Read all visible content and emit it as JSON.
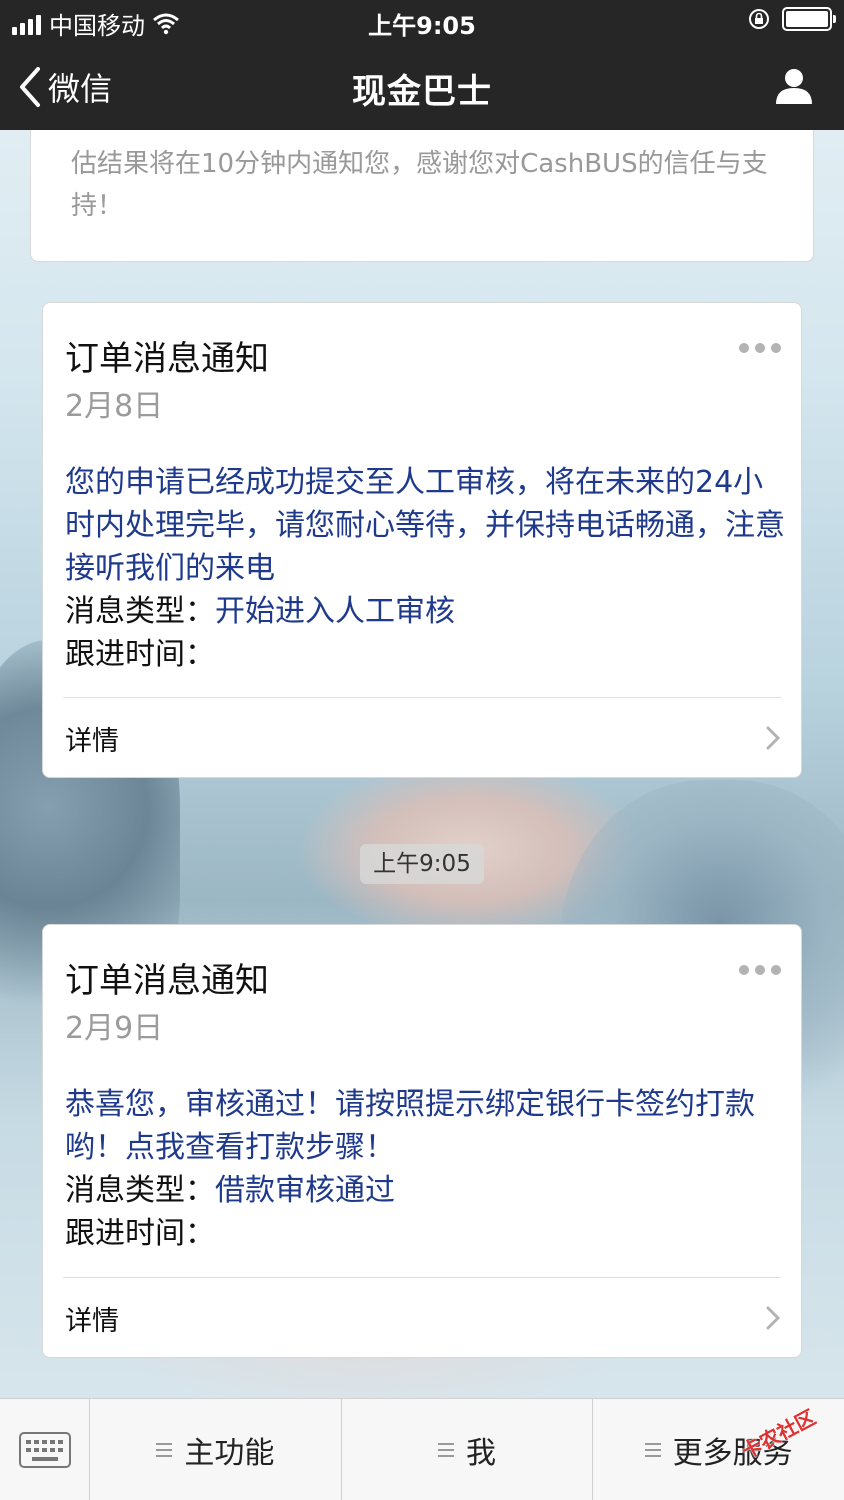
{
  "status_bar": {
    "carrier": "中国移动",
    "time": "上午9:05"
  },
  "nav": {
    "back_label": "微信",
    "title": "现金巴士"
  },
  "top_card": {
    "text": "估结果将在10分钟内通知您，感谢您对CashBUS的信任与支持！"
  },
  "messages": [
    {
      "title": "订单消息通知",
      "date": "2月8日",
      "body": "您的申请已经成功提交至人工审核，将在未来的24小时内处理完毕，请您耐心等待，并保持电话畅通，注意接听我们的来电",
      "type_label": "消息类型：",
      "type_value": "开始进入人工审核",
      "followup_label": "跟进时间：",
      "detail_label": "详情"
    },
    {
      "title": "订单消息通知",
      "date": "2月9日",
      "body": "恭喜您，审核通过！请按照提示绑定银行卡签约打款哟！点我查看打款步骤！",
      "type_label": "消息类型：",
      "type_value": "借款审核通过",
      "followup_label": "跟进时间：",
      "detail_label": "详情"
    }
  ],
  "timestamp": "上午9:05",
  "bottom_menu": {
    "items": [
      "主功能",
      "我",
      "更多服务"
    ]
  },
  "watermark": "卡农社区",
  "colors": {
    "bar_bg": "#262626",
    "link_blue": "#1f3a8c",
    "muted": "#9b9b9b"
  }
}
